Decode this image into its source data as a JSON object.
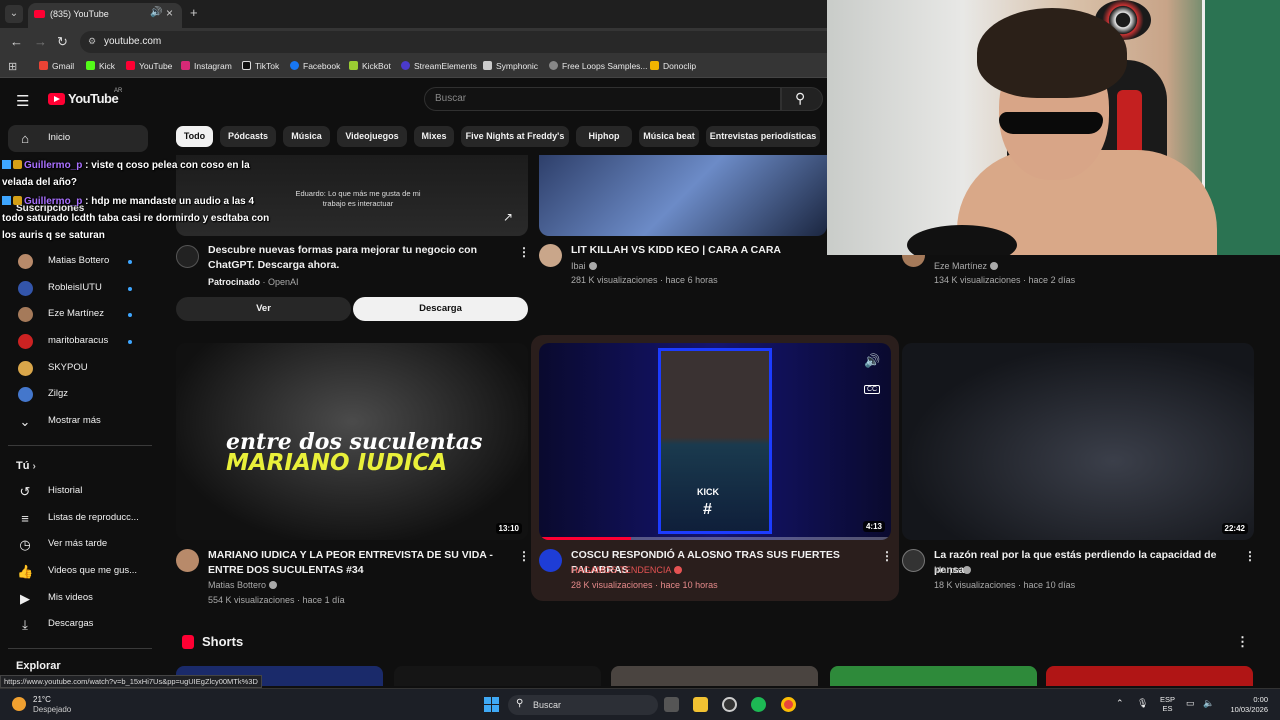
{
  "browser": {
    "tab_title": "(835) YouTube",
    "url": "youtube.com",
    "bookmarks": [
      "Gmail",
      "Kick",
      "YouTube",
      "Instagram",
      "TikTok",
      "Facebook",
      "KickBot",
      "StreamElements",
      "Symphonic",
      "Free Loops Samples...",
      "Donoclip"
    ],
    "status_url": "https://www.youtube.com/watch?v=b_15xHi7Us&pp=ugUIEgZlcy00MTk%3D"
  },
  "header": {
    "logo": "YouTube",
    "region": "AR",
    "search_placeholder": "Buscar"
  },
  "sidebar": {
    "home": "Inicio",
    "subscriptions_label": "Suscripciones",
    "channels": [
      {
        "label": "Matias Bottero",
        "color": "#b88a6a"
      },
      {
        "label": "RobleisIUTU",
        "color": "#3355aa"
      },
      {
        "label": "Eze Martínez",
        "color": "#a57a5a"
      },
      {
        "label": "maritobaracus",
        "color": "#cc2222"
      },
      {
        "label": "SKYPOU",
        "color": "#d9a64a"
      },
      {
        "label": "Zilgz",
        "color": "#4477cc"
      }
    ],
    "show_more": "Mostrar más",
    "you_label": "Tú",
    "you_items": [
      "Historial",
      "Listas de reproducc...",
      "Ver más tarde",
      "Videos que me gus...",
      "Mis videos",
      "Descargas"
    ],
    "explore_label": "Explorar"
  },
  "chat": [
    {
      "user": "Guillermo_p",
      "text": "viste q coso pelea con coso en la velada del año?"
    },
    {
      "user": "Guillermo_p",
      "text": "hdp me mandaste un audio a las 4 todo saturado lcdth taba casi re dormirdo y esdtaba con los auris q se saturan"
    }
  ],
  "chips": [
    "Todo",
    "Pódcasts",
    "Música",
    "Videojuegos",
    "Mixes",
    "Five Nights at Freddy's",
    "Hiphop",
    "Música beat",
    "Entrevistas periodísticas"
  ],
  "row1": {
    "ad": {
      "caption": "Eduardo: Lo que más me gusta de mi trabajo es interactuar",
      "title": "Descubre nuevas formas para mejorar tu negocio con ChatGPT. Descarga ahora.",
      "sponsored": "Patrocinado",
      "advertiser": "OpenAI",
      "btn_view": "Ver",
      "btn_download": "Descarga"
    },
    "v1": {
      "title": "LIT KILLAH VS KIDD KEO | CARA A CARA",
      "channel": "Ibai",
      "meta": "281 K visualizaciones · hace 6 horas"
    },
    "v2": {
      "channel": "Eze Martínez",
      "meta": "134 K visualizaciones · hace 2 días"
    }
  },
  "row2": [
    {
      "thumb_line1": "entre dos suculentas",
      "thumb_line2": "MARIANO IUDICA",
      "duration": "13:10",
      "title": "MARIANO IUDICA Y LA PEOR ENTREVISTA DE SU VIDA - ENTRE DOS SUCULENTAS #34",
      "channel": "Matias Bottero",
      "meta": "554 K visualizaciones · hace 1 día"
    },
    {
      "thumb_kick": "KICK",
      "thumb_hash": "#",
      "duration": "4:13",
      "progress": 0.26,
      "title": "COSCU RESPONDIÓ A ALOSNO TRAS SUS FUERTES PALABRAS",
      "channel": "HAGAMOS TENDENCIA",
      "meta": "28 K visualizaciones · hace 10 horas"
    },
    {
      "duration": "22:42",
      "title": "La razón real por la que estás perdiendo la capacidad de pensar",
      "channel": "Marpe",
      "meta": "18 K visualizaciones · hace 10 días"
    }
  ],
  "shorts": {
    "title": "Shorts"
  },
  "taskbar": {
    "temp": "21°C",
    "weather": "Despejado",
    "search": "Buscar",
    "lang1": "ESP",
    "lang2": "ES",
    "time": "0:00",
    "date": "10/03/2026"
  },
  "colors": {
    "accent_red": "#ff0033",
    "link_blue": "#3ea6ff",
    "chat_user": "#a970ff",
    "channel_red": "#e55353"
  }
}
